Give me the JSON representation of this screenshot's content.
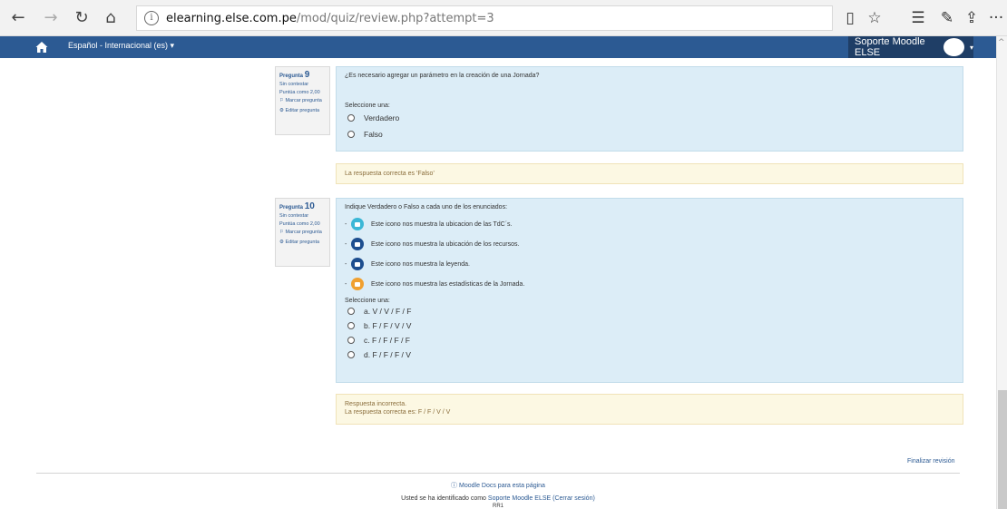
{
  "browser": {
    "url_host": "elearning.else.com.pe",
    "url_path": "/mod/quiz/review.php?attempt=3",
    "back_icon": "←",
    "forward_icon": "→",
    "refresh_icon": "↻",
    "home_icon": "⌂",
    "info_icon": "i",
    "reading_icon": "▯",
    "star_icon": "☆",
    "favorites_icon": "☰",
    "notes_icon": "✎",
    "share_icon": "⇪",
    "more_icon": "···"
  },
  "navbar": {
    "language": "Español - Internacional (es) ▾",
    "user": "Soporte Moodle ELSE",
    "caret": "▾",
    "scroll_up": "^",
    "bg_color": "#2c5a93"
  },
  "questions": [
    {
      "label": "Pregunta",
      "number": "9",
      "state": "Sin contestar",
      "marks": "Puntúa como 2,00",
      "flag_icon": "⚐",
      "flag": "Marcar pregunta",
      "edit_icon": "⚙",
      "edit": "Editar pregunta",
      "text": "¿Es necesario agregar un parámetro en la creación de una Jornada?",
      "prompt": "Seleccione una:",
      "options": [
        "Verdadero",
        "Falso"
      ],
      "feedback": "La respuesta correcta es 'Falso'"
    },
    {
      "label": "Pregunta",
      "number": "10",
      "state": "Sin contestar",
      "marks": "Puntúa como 2,00",
      "flag_icon": "⚐",
      "flag": "Marcar pregunta",
      "edit_icon": "⚙",
      "edit": "Editar pregunta",
      "text": "Indique Verdadero o Falso a cada uno de los enunciados:",
      "statements": [
        {
          "dash": "-",
          "text": "Este icono nos muestra la ubicacion de las TdC´s.",
          "color": "#3bb7d6"
        },
        {
          "dash": "-",
          "text": "Este icono nos muestra la ubicación de los recursos.",
          "color": "#1d4e8f"
        },
        {
          "dash": "-",
          "text": "Este icono nos muestra la leyenda.",
          "color": "#1d4e8f"
        },
        {
          "dash": "-",
          "text": "Este icono nos muestra las estadísticas de la Jornada.",
          "color": "#f0a030"
        }
      ],
      "prompt": "Seleccione una:",
      "options": [
        "a. V / V / F / F",
        "b. F / F / V / V",
        "c. F / F / F / F",
        "d. F / F / F / V"
      ],
      "feedback1": "Respuesta incorrecta.",
      "feedback2": "La respuesta correcta es: F / F / V / V"
    }
  ],
  "footer": {
    "finish": "Finalizar revisión",
    "docs_icon": "ⓘ",
    "docs": "Moodle Docs para esta página",
    "login_prefix": "Usted se ha identificado como",
    "login_user": "Soporte Moodle ELSE",
    "logout": "(Cerrar sesión)",
    "ref": "RR1"
  }
}
